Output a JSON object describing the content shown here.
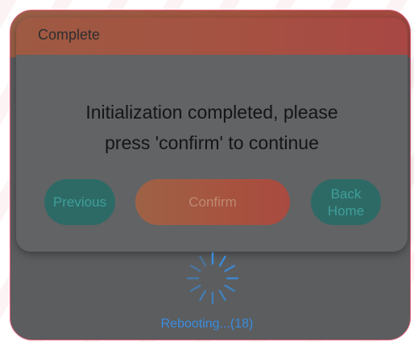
{
  "dialog": {
    "title": "Complete",
    "message_line1": "Initialization completed, please",
    "message_line2": "press 'confirm' to continue"
  },
  "buttons": {
    "previous_label": "Previous",
    "confirm_label": "Confirm",
    "back_home_line1": "Back",
    "back_home_line2": "Home"
  },
  "status": {
    "text": "Rebooting...(18)",
    "spinner_icon": "loading-spinner-icon"
  },
  "colors": {
    "accent_border": "#e0607a",
    "header_gradient_start": "#9e5a43",
    "header_gradient_end": "#a84744",
    "teal_button": "#2d6a66",
    "status_blue": "#3a8de0"
  }
}
